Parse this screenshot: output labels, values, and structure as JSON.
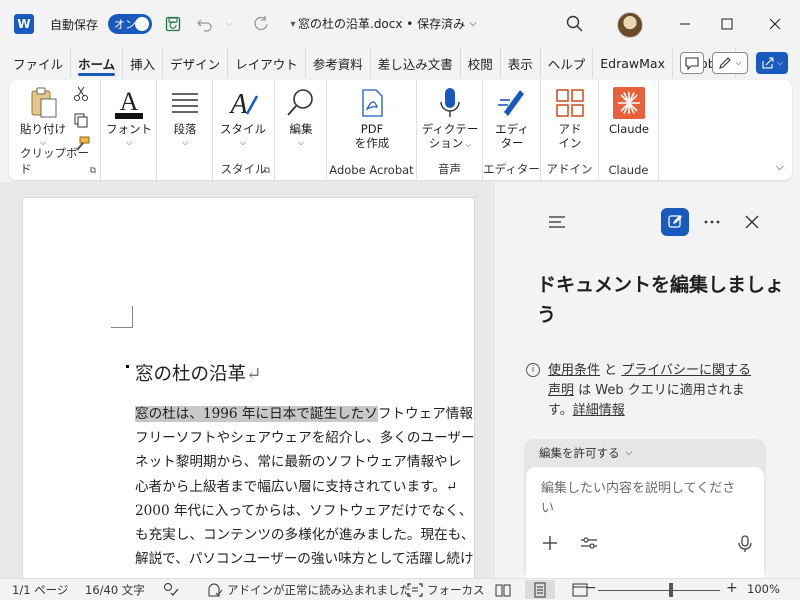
{
  "titlebar": {
    "autosave_label": "自動保存",
    "autosave_state": "オン",
    "doc_title": "窓の杜の沿革.docx • 保存済み",
    "caret": "⌵"
  },
  "tabs": [
    {
      "label": "ファイル"
    },
    {
      "label": "ホーム",
      "active": true
    },
    {
      "label": "挿入"
    },
    {
      "label": "デザイン"
    },
    {
      "label": "レイアウト"
    },
    {
      "label": "参考資料"
    },
    {
      "label": "差し込み文書"
    },
    {
      "label": "校閲"
    },
    {
      "label": "表示"
    },
    {
      "label": "ヘルプ"
    },
    {
      "label": "EdrawMax"
    },
    {
      "label": "Acrobat"
    }
  ],
  "ribbon": {
    "paste_label": "貼り付け",
    "clipboard_group": "クリップボード",
    "font_label": "フォント",
    "paragraph_label": "段落",
    "style_label": "スタイル",
    "style_group": "スタイル",
    "edit_label": "編集",
    "pdf_label_1": "PDF",
    "pdf_label_2": "を作成",
    "adobe_group": "Adobe Acrobat",
    "dictate_label_1": "ディクテー",
    "dictate_label_2": "ション",
    "voice_group": "音声",
    "editor_label_1": "エディ",
    "editor_label_2": "ター",
    "editor_group": "エディター",
    "addin_label_1": "アド",
    "addin_label_2": "イン",
    "addin_group": "アドイン",
    "claude_label": "Claude",
    "claude_group": "Claude"
  },
  "document": {
    "heading": "窓の杜の沿革",
    "return_mark": "↵",
    "lines": [
      {
        "hl": "窓の杜は、1996 年に日本で誕生したソ",
        "rest": "フトウェア情報"
      },
      {
        "hl": "",
        "rest": "フリーソフトやシェアウェアを紹介し、多くのユーザー"
      },
      {
        "hl": "",
        "rest": "ネット黎明期から、常に最新のソフトウェア情報やレ"
      },
      {
        "hl": "",
        "rest": "心者から上級者まで幅広い層に支持されています。↵"
      },
      {
        "hl": "",
        "rest": "2000 年代に入ってからは、ソフトウェアだけでなく、"
      },
      {
        "hl": "",
        "rest": "も充実し、コンテンツの多様化が進みました。現在も、"
      },
      {
        "hl": "",
        "rest": "解説で、パソコンユーザーの強い味方として活躍し続け"
      }
    ]
  },
  "pane": {
    "heading": "ドキュメントを編集しましょう",
    "terms_link_1": "使用条件",
    "terms_and": " と ",
    "terms_link_2": "プライバシーに関する声明",
    "terms_tail": " は Web クエリに適用されます。",
    "terms_link_3": "詳細情報",
    "permission": "編集を許可する",
    "placeholder": "編集したい内容を説明してください"
  },
  "statusbar": {
    "page": "1/1 ページ",
    "words": "16/40 文字",
    "addin_status": "アドインが正常に読み込まれました",
    "focus": "フォーカス",
    "zoom_minus": "−",
    "zoom_plus": "+",
    "zoom": "100%"
  },
  "colors": {
    "accent": "#185abd",
    "claude": "#e8603c"
  }
}
